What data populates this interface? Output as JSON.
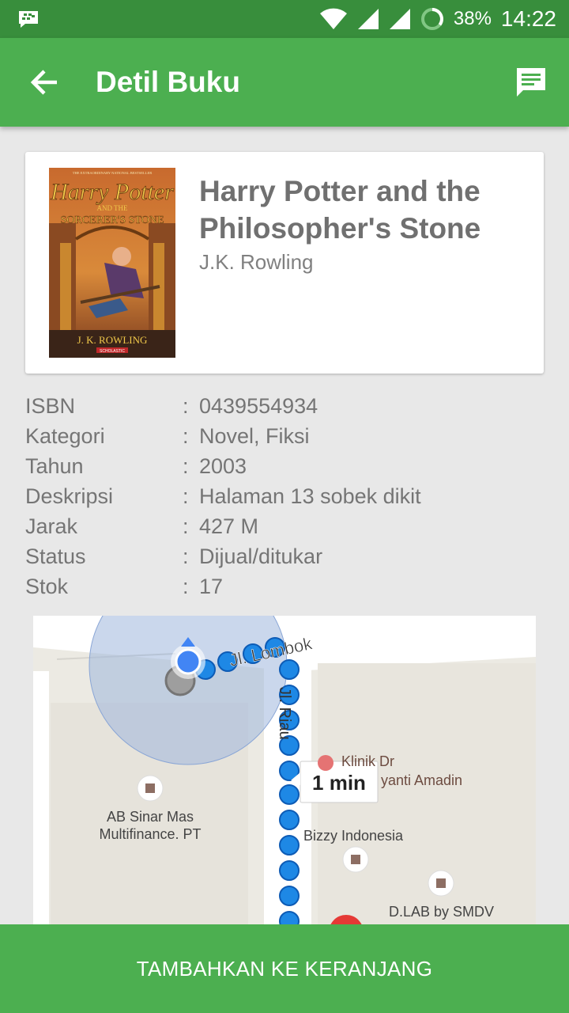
{
  "status_bar": {
    "battery_percent": "38%",
    "time": "14:22"
  },
  "app_bar": {
    "title": "Detil Buku"
  },
  "book": {
    "title": "Harry Potter and the Philosopher's Stone",
    "author": "J.K. Rowling",
    "cover": {
      "top_line": "THE EXTRAORDINARY NATIONAL BESTSELLER",
      "title_1": "Harry Potter",
      "title_2": "AND THE",
      "title_3": "SORCERER'S STONE",
      "author": "J. K. ROWLING",
      "publisher": "SCHOLASTIC"
    }
  },
  "details": {
    "separator": ":",
    "rows": [
      {
        "label": "ISBN",
        "value": "0439554934"
      },
      {
        "label": "Kategori",
        "value": "Novel, Fiksi"
      },
      {
        "label": "Tahun",
        "value": "2003"
      },
      {
        "label": "Deskripsi",
        "value": "Halaman 13 sobek dikit"
      },
      {
        "label": "Jarak",
        "value": "427 M"
      },
      {
        "label": "Status",
        "value": "Dijual/ditukar"
      },
      {
        "label": "Stok",
        "value": "17"
      }
    ]
  },
  "map": {
    "street_lombok": "Jl. Lombok",
    "street_riau": "Jl. Riau",
    "eta": "1 min",
    "poi_ab_line1": "AB Sinar Mas",
    "poi_ab_line2": "Multifinance. PT",
    "poi_klinik_line1": "Klinik Dr",
    "poi_klinik_line2": "yanti Amadin",
    "poi_bizzy": "Bizzy Indonesia",
    "poi_dlab": "D.LAB by SMDV"
  },
  "actions": {
    "add_to_cart": "TAMBAHKAN KE KERANJANG"
  },
  "colors": {
    "primary": "#4caf50",
    "primary_dark": "#388e3c",
    "route_blue": "#1e88e5"
  }
}
